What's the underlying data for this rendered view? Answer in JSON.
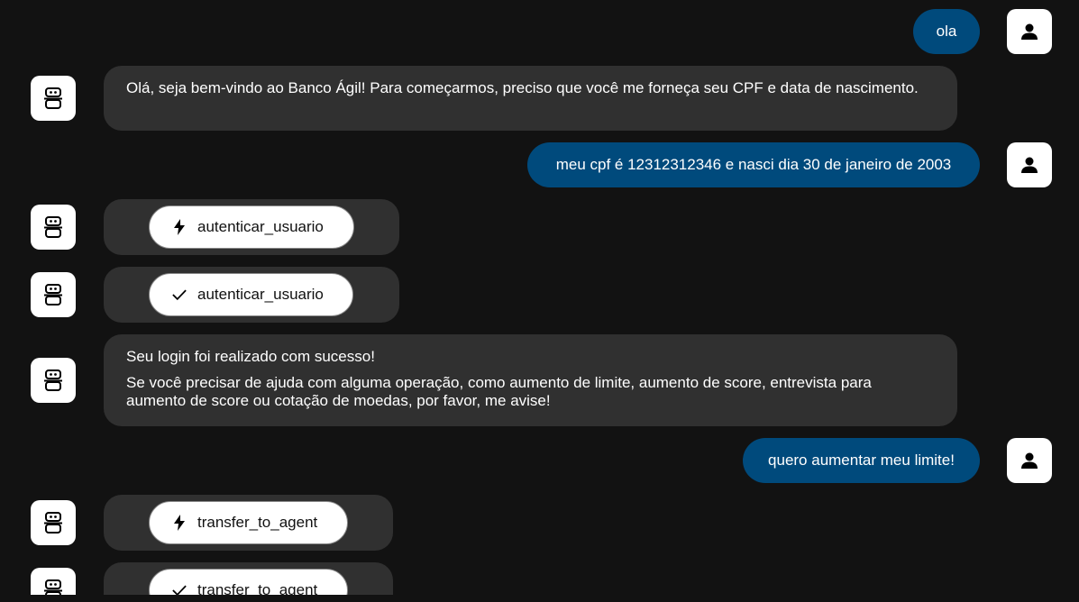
{
  "messages": [
    {
      "role": "user",
      "text": "ola"
    },
    {
      "role": "assistant",
      "text": "Olá, seja bem-vindo ao Banco Ágil! Para começarmos, preciso que você me forneça seu CPF e data de nascimento."
    },
    {
      "role": "user",
      "text": "meu cpf é 12312312346 e nasci dia 30 de janeiro de 2003"
    },
    {
      "role": "tool",
      "status": "running",
      "icon": "bolt-icon",
      "name": "autenticar_usuario"
    },
    {
      "role": "tool",
      "status": "done",
      "icon": "check-icon",
      "name": "autenticar_usuario"
    },
    {
      "role": "assistant",
      "paragraphs": [
        "Seu login foi realizado com sucesso!",
        "Se você precisar de ajuda com alguma operação, como aumento de limite, aumento de score, entrevista para aumento de score ou cotação de moedas, por favor, me avise!"
      ]
    },
    {
      "role": "user",
      "text": "quero aumentar meu limite!"
    },
    {
      "role": "tool",
      "status": "running",
      "icon": "bolt-icon",
      "name": "transfer_to_agent"
    },
    {
      "role": "tool",
      "status": "done",
      "icon": "check-icon",
      "name": "transfer_to_agent"
    }
  ],
  "colors": {
    "background": "#121212",
    "user_bubble": "#004a7c",
    "assistant_bubble": "#303030",
    "avatar_bg": "#ffffff"
  },
  "icons": {
    "user_avatar": "person-icon",
    "bot_avatar": "robot-icon"
  }
}
